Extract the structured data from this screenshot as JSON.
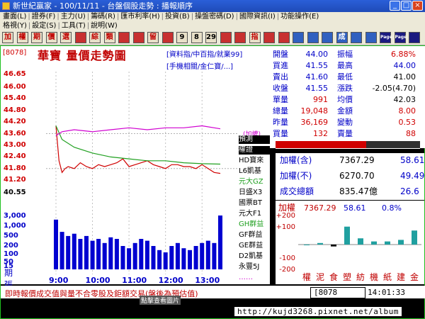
{
  "window": {
    "title": "新世紀贏家 - 100/11/11 - 台盤個股走勢 : 播報順序"
  },
  "menu": {
    "row1": [
      "畫面(L)",
      "證券(F)",
      "主力(U)",
      "籌碼(R)",
      "匯市利率(H)",
      "投資(B)",
      "操盤密碼(D)",
      "國際資訊(I)",
      "功能操作(E)"
    ],
    "row2": [
      "格視(Y)",
      "設定(S)",
      "工具(T)",
      "說明(W)"
    ],
    "fnkeys": "功能操作(E)"
  },
  "toolbar": {
    "buttons": [
      {
        "label": "加",
        "bg": "#e8e0c8",
        "fg": "#c00000"
      },
      {
        "label": "權",
        "bg": "#e8e0c8",
        "fg": "#c00000"
      },
      {
        "label": "期",
        "bg": "#e8e0c8",
        "fg": "#c00000"
      },
      {
        "label": "價",
        "bg": "#e8e0c8",
        "fg": "#c00000"
      },
      {
        "label": "選",
        "bg": "#e8e0c8",
        "fg": "#c00000"
      },
      {
        "label": "",
        "bg": "#c83030",
        "fg": "#ffffff"
      },
      {
        "label": "綜",
        "bg": "#e8e0c8",
        "fg": "#c00000"
      },
      {
        "label": "類",
        "bg": "#e8e0c8",
        "fg": "#c00000"
      },
      {
        "label": "",
        "bg": "#c83030",
        "fg": "#ffffff"
      },
      {
        "label": "",
        "bg": "#c83030",
        "fg": "#ffffff"
      },
      {
        "label": "留",
        "bg": "#e8e0c8",
        "fg": "#c00000"
      },
      {
        "label": "",
        "bg": "#c83030",
        "fg": "#ffffff"
      },
      {
        "label": "9",
        "bg": "#e8e0c8",
        "fg": "#000000"
      },
      {
        "label": "8",
        "bg": "#e8e0c8",
        "fg": "#000000"
      },
      {
        "label": "29",
        "bg": "#e8e0c8",
        "fg": "#000000"
      },
      {
        "label": "",
        "bg": "#c83030",
        "fg": "#ffffff"
      },
      {
        "label": "",
        "bg": "#c83030",
        "fg": "#ffffff"
      },
      {
        "label": "指",
        "bg": "#e8e0c8",
        "fg": "#c00000"
      },
      {
        "label": "",
        "bg": "#c83030",
        "fg": "#ffffff"
      },
      {
        "label": "",
        "bg": "#c83030",
        "fg": "#ffffff"
      },
      {
        "label": "",
        "bg": "#3060c0",
        "fg": "#ffffff"
      },
      {
        "label": "",
        "bg": "#3060c0",
        "fg": "#ffffff"
      },
      {
        "label": "",
        "bg": "#3060c0",
        "fg": "#ffffff"
      },
      {
        "label": "成",
        "bg": "#3060c0",
        "fg": "#ffffff"
      },
      {
        "label": "",
        "bg": "#3060c0",
        "fg": "#ffffff"
      },
      {
        "label": "",
        "bg": "#3060c0",
        "fg": "#ffffff"
      },
      {
        "label": "Page",
        "bg": "#1a1a80",
        "fg": "#ffffff"
      },
      {
        "label": "Page",
        "bg": "#1a1a80",
        "fg": "#ffffff"
      },
      {
        "label": "",
        "bg": "#1a1a80",
        "fg": "#ffffff"
      }
    ]
  },
  "chart_header": {
    "code": "[8078]",
    "name": "華寶  量價走勢圖",
    "links1": "[資料指/中百指/就業99]",
    "links2": "[手機相關/金仁寶/...]"
  },
  "price_axis": [
    "46.65",
    "46.00",
    "45.40",
    "44.80",
    "44.20",
    "43.60",
    "43.00",
    "42.40",
    "41.80",
    "41.20",
    "40.55"
  ],
  "volume_axis": [
    "3,000",
    "1,000",
    "500",
    "200",
    "100",
    "50",
    "15"
  ],
  "volume_label": [
    "期",
    "張"
  ],
  "time_axis": [
    "9:00",
    "10:00",
    "11:00",
    "12:00",
    "13:00"
  ],
  "side_list": {
    "add_label": "(加權)",
    "items": [
      {
        "label": "預測",
        "color": "#000000",
        "bg": "#000000",
        "fg": "#ffffff"
      },
      {
        "label": "權證",
        "color": "#000000",
        "bg": "#000000",
        "fg": "#ffffff"
      },
      {
        "label": "HD寶來",
        "color": "#000000"
      },
      {
        "label": "L6凱基",
        "color": "#000000"
      },
      {
        "label": "元大GZ",
        "color": "#20a020"
      },
      {
        "label": "日盛X3",
        "color": "#000000"
      },
      {
        "label": "國票BT",
        "color": "#000000"
      },
      {
        "label": "元大F1",
        "color": "#000000"
      },
      {
        "label": "GH群益",
        "color": "#20a020"
      },
      {
        "label": "GF群益",
        "color": "#000000"
      },
      {
        "label": "GE群益",
        "color": "#000000"
      },
      {
        "label": "D2凱基",
        "color": "#000000"
      },
      {
        "label": "永豐5J",
        "color": "#000000"
      },
      {
        "label": "‥‥‥",
        "color": "#d000d0"
      }
    ]
  },
  "quote": {
    "rows": [
      {
        "k1": "開盤",
        "v1": "44.00",
        "c1": "#0000c8",
        "k2": "振幅",
        "v2": "6.88%",
        "c2": "#d00000"
      },
      {
        "k1": "買進",
        "v1": "41.55",
        "c1": "#0000c8",
        "k2": "最高",
        "v2": "44.00",
        "c2": "#0000c8"
      },
      {
        "k1": "賣出",
        "v1": "41.60",
        "c1": "#0000c8",
        "k2": "最低",
        "v2": "41.00",
        "c2": "#000000"
      },
      {
        "k1": "收盤",
        "v1": "41.55",
        "c1": "#0000c8",
        "k2": "漲跌",
        "v2": "-2.05(4.70)",
        "c2": "#000000"
      },
      {
        "k1": "單量",
        "v1": "991",
        "c1": "#d00000",
        "k2": "均價",
        "v2": "42.03",
        "c2": "#000000"
      },
      {
        "k1": "總量",
        "v1": "19,048",
        "c1": "#d00000",
        "k2": "金額",
        "v2": "8.00",
        "c2": "#d00000"
      },
      {
        "k1": "昨量",
        "v1": "36,169",
        "c1": "#d00000",
        "k2": "變動",
        "v2": "0.53",
        "c2": "#d00000"
      },
      {
        "k1": "買量",
        "v1": "132",
        "c1": "#d00000",
        "k2": "賣量",
        "v2": "88",
        "c2": "#d00000"
      }
    ]
  },
  "index_panel": {
    "rows": [
      {
        "label": "加權(含)",
        "value": "7367.29",
        "change": "58.61"
      },
      {
        "label": "加權(不)",
        "value": "6270.70",
        "change": "49.49"
      },
      {
        "label": "成交總額",
        "value": "835.47億",
        "change": "26.6"
      }
    ]
  },
  "sector_panel": {
    "header_label": "加權",
    "header_value": "7367.29",
    "header_change": "58.61",
    "header_pct": "0.8%",
    "y_labels": [
      "+200",
      "+100",
      "-100",
      "-200"
    ],
    "categories": [
      "權",
      "泥",
      "食",
      "塑",
      "紡",
      "機",
      "紙",
      "建",
      "金"
    ],
    "bar_values": [
      0,
      10,
      -12,
      115,
      40,
      20,
      20,
      30,
      90
    ]
  },
  "chart_data": {
    "type": "line",
    "title": "華寶  量價走勢圖",
    "xlabel": "",
    "ylabel": "",
    "ylim": [
      40.55,
      46.65
    ],
    "x_ticks": [
      "9:00",
      "10:00",
      "11:00",
      "12:00",
      "13:00"
    ],
    "series": [
      {
        "color": "#d00000",
        "x": [
          "9:00",
          "9:05",
          "9:10",
          "9:15",
          "9:20",
          "9:30",
          "9:40",
          "9:50",
          "10:00",
          "10:10",
          "10:20",
          "10:30",
          "10:40",
          "10:50",
          "11:00",
          "11:10",
          "11:20",
          "11:30",
          "11:40",
          "11:50",
          "12:00",
          "12:10",
          "12:20",
          "12:30",
          "12:40",
          "12:50",
          "13:00",
          "13:10",
          "13:20",
          "13:30"
        ],
        "values": [
          44.0,
          42.2,
          41.6,
          41.8,
          41.9,
          41.8,
          42.1,
          41.9,
          41.8,
          42.0,
          41.9,
          42.0,
          42.1,
          42.3,
          41.9,
          42.0,
          42.1,
          42.2,
          42.0,
          41.9,
          41.8,
          42.0,
          42.0,
          41.9,
          41.9,
          41.8,
          42.0,
          41.8,
          41.6,
          41.55
        ]
      },
      {
        "color": "#20a020",
        "x": [
          "9:00",
          "9:10",
          "9:30",
          "10:00",
          "10:30",
          "11:00",
          "11:30",
          "12:00",
          "12:30",
          "13:00",
          "13:30"
        ],
        "values": [
          44.0,
          43.3,
          42.9,
          42.6,
          42.4,
          42.3,
          42.2,
          42.2,
          42.1,
          42.05,
          42.03
        ]
      },
      {
        "color": "#d000d0",
        "x": [
          "9:00",
          "9:10",
          "9:30",
          "10:00",
          "10:30",
          "11:00",
          "11:30",
          "12:00",
          "12:30",
          "13:00",
          "13:30"
        ],
        "values": [
          43.5,
          43.7,
          43.8,
          43.7,
          43.8,
          43.9,
          43.8,
          43.9,
          43.9,
          44.0,
          43.85
        ]
      }
    ],
    "volume": {
      "color": "#0000d0",
      "x": [
        "9:00",
        "9:10",
        "9:20",
        "9:30",
        "9:40",
        "9:50",
        "10:00",
        "10:10",
        "10:20",
        "10:30",
        "10:40",
        "10:50",
        "11:00",
        "11:10",
        "11:20",
        "11:30",
        "11:40",
        "11:50",
        "12:00",
        "12:10",
        "12:20",
        "12:30",
        "12:40",
        "12:50",
        "13:00",
        "13:10",
        "13:20",
        "13:30"
      ],
      "values": [
        2000,
        600,
        400,
        500,
        300,
        400,
        250,
        300,
        200,
        350,
        300,
        150,
        120,
        200,
        300,
        250,
        150,
        100,
        80,
        150,
        200,
        120,
        100,
        150,
        200,
        250,
        200,
        3000
      ]
    }
  },
  "status": {
    "notice": "即時報價成交值與量不合零股及鉅額交易(盤後為預估值)",
    "overlay": "點擊查看圖片",
    "code": "8078",
    "clock": "14:01:33",
    "url": "http://kujd3268.pixnet.net/album"
  }
}
